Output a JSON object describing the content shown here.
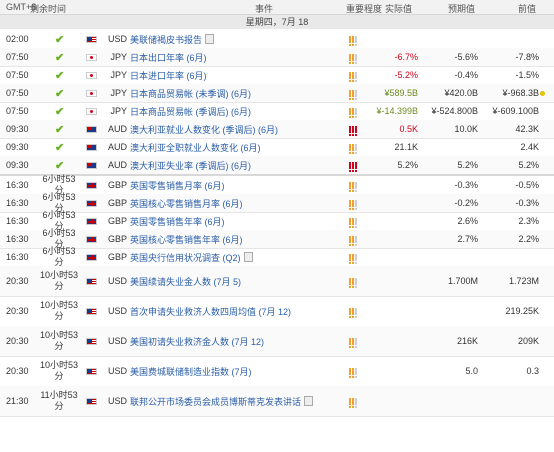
{
  "header": {
    "tz": "GMT+8",
    "remaining": "剩余时间",
    "event": "事件",
    "importance": "重要程度",
    "actual": "实际值",
    "forecast": "预期值",
    "previous": "前值"
  },
  "date_band": "星期四，7月 18",
  "colors": {
    "link": "#2a5ea8",
    "negative": "#d0021b",
    "positive": "#6a8a1f",
    "importance_high": "#d0021b",
    "importance_mid": "#f0a030"
  },
  "rows": [
    {
      "time": "02:00",
      "rem": "",
      "check": true,
      "flag": "us",
      "cur": "USD",
      "evt": "美联储褐皮书报告",
      "doc": true,
      "imp": "mid",
      "act": "",
      "act_color": "",
      "fc": "",
      "prev": ""
    },
    {
      "time": "07:50",
      "rem": "",
      "check": true,
      "flag": "jp",
      "cur": "JPY",
      "evt": "日本出口年率 (6月)",
      "imp": "mid",
      "act": "-6.7%",
      "act_color": "red",
      "fc": "-5.6%",
      "prev": "-7.8%"
    },
    {
      "time": "07:50",
      "rem": "",
      "check": true,
      "flag": "jp",
      "cur": "JPY",
      "evt": "日本进口年率 (6月)",
      "imp": "mid",
      "act": "-5.2%",
      "act_color": "red",
      "fc": "-0.4%",
      "prev": "-1.5%"
    },
    {
      "time": "07:50",
      "rem": "",
      "check": true,
      "flag": "jp",
      "cur": "JPY",
      "evt": "日本商品贸易帐 (未季调) (6月)",
      "imp": "mid",
      "act": "¥589.5B",
      "act_color": "green",
      "fc": "¥420.0B",
      "prev": "¥-968.3B",
      "dot": true
    },
    {
      "time": "07:50",
      "rem": "",
      "check": true,
      "flag": "jp",
      "cur": "JPY",
      "evt": "日本商品贸易帐 (季调后) (6月)",
      "imp": "mid",
      "act": "¥-14.399B",
      "act_color": "green",
      "fc": "¥-524.800B",
      "prev": "¥-609.100B"
    },
    {
      "time": "09:30",
      "rem": "",
      "check": true,
      "flag": "au",
      "cur": "AUD",
      "evt": "澳大利亚就业人数变化 (季调后) (6月)",
      "imp": "high",
      "act": "0.5K",
      "act_color": "red",
      "fc": "10.0K",
      "prev": "42.3K"
    },
    {
      "time": "09:30",
      "rem": "",
      "check": true,
      "flag": "au",
      "cur": "AUD",
      "evt": "澳大利亚全职就业人数变化 (6月)",
      "imp": "mid",
      "act": "21.1K",
      "act_color": "",
      "fc": "",
      "prev": "2.4K"
    },
    {
      "time": "09:30",
      "rem": "",
      "check": true,
      "flag": "au",
      "cur": "AUD",
      "evt": "澳大利亚失业率 (季调后) (6月)",
      "imp": "high",
      "act": "5.2%",
      "act_color": "",
      "fc": "5.2%",
      "prev": "5.2%"
    },
    {
      "time": "16:30",
      "rem": "6小时53分",
      "check": false,
      "flag": "gb",
      "cur": "GBP",
      "evt": "英国零售销售月率 (6月)",
      "imp": "mid",
      "act": "",
      "act_color": "",
      "fc": "-0.3%",
      "prev": "-0.5%"
    },
    {
      "time": "16:30",
      "rem": "6小时53分",
      "check": false,
      "flag": "gb",
      "cur": "GBP",
      "evt": "英国核心零售销售月率 (6月)",
      "imp": "mid",
      "act": "",
      "act_color": "",
      "fc": "-0.2%",
      "prev": "-0.3%"
    },
    {
      "time": "16:30",
      "rem": "6小时53分",
      "check": false,
      "flag": "gb",
      "cur": "GBP",
      "evt": "英国零售销售年率 (6月)",
      "imp": "mid",
      "act": "",
      "act_color": "",
      "fc": "2.6%",
      "prev": "2.3%"
    },
    {
      "time": "16:30",
      "rem": "6小时53分",
      "check": false,
      "flag": "gb",
      "cur": "GBP",
      "evt": "英国核心零售销售年率 (6月)",
      "imp": "mid",
      "act": "",
      "act_color": "",
      "fc": "2.7%",
      "prev": "2.2%"
    },
    {
      "time": "16:30",
      "rem": "6小时53分",
      "check": false,
      "flag": "gb",
      "cur": "GBP",
      "evt": "英国央行信用状况调查 (Q2)",
      "doc": true,
      "imp": "mid",
      "act": "",
      "act_color": "",
      "fc": "",
      "prev": ""
    },
    {
      "time": "20:30",
      "rem": "10小时53分",
      "check": false,
      "flag": "us",
      "cur": "USD",
      "evt": "美国续请失业金人数 (7月 5)",
      "imp": "mid",
      "act": "",
      "act_color": "",
      "fc": "1.700M",
      "prev": "1.723M"
    },
    {
      "time": "20:30",
      "rem": "10小时53分",
      "check": false,
      "flag": "us",
      "cur": "USD",
      "evt": "首次申请失业救济人数四周均值 (7月 12)",
      "imp": "mid",
      "act": "",
      "act_color": "",
      "fc": "",
      "prev": "219.25K"
    },
    {
      "time": "20:30",
      "rem": "10小时53分",
      "check": false,
      "flag": "us",
      "cur": "USD",
      "evt": "美国初请失业救济金人数 (7月 12)",
      "imp": "mid",
      "act": "",
      "act_color": "",
      "fc": "216K",
      "prev": "209K"
    },
    {
      "time": "20:30",
      "rem": "10小时53分",
      "check": false,
      "flag": "us",
      "cur": "USD",
      "evt": "美国费城联储制造业指数 (7月)",
      "imp": "mid",
      "act": "",
      "act_color": "",
      "fc": "5.0",
      "prev": "0.3"
    },
    {
      "time": "21:30",
      "rem": "11小时53分",
      "check": false,
      "flag": "us",
      "cur": "USD",
      "evt": "联邦公开市场委员会成员博斯蒂克发表讲话",
      "doc": true,
      "imp": "mid",
      "act": "",
      "act_color": "",
      "fc": "",
      "prev": ""
    }
  ]
}
